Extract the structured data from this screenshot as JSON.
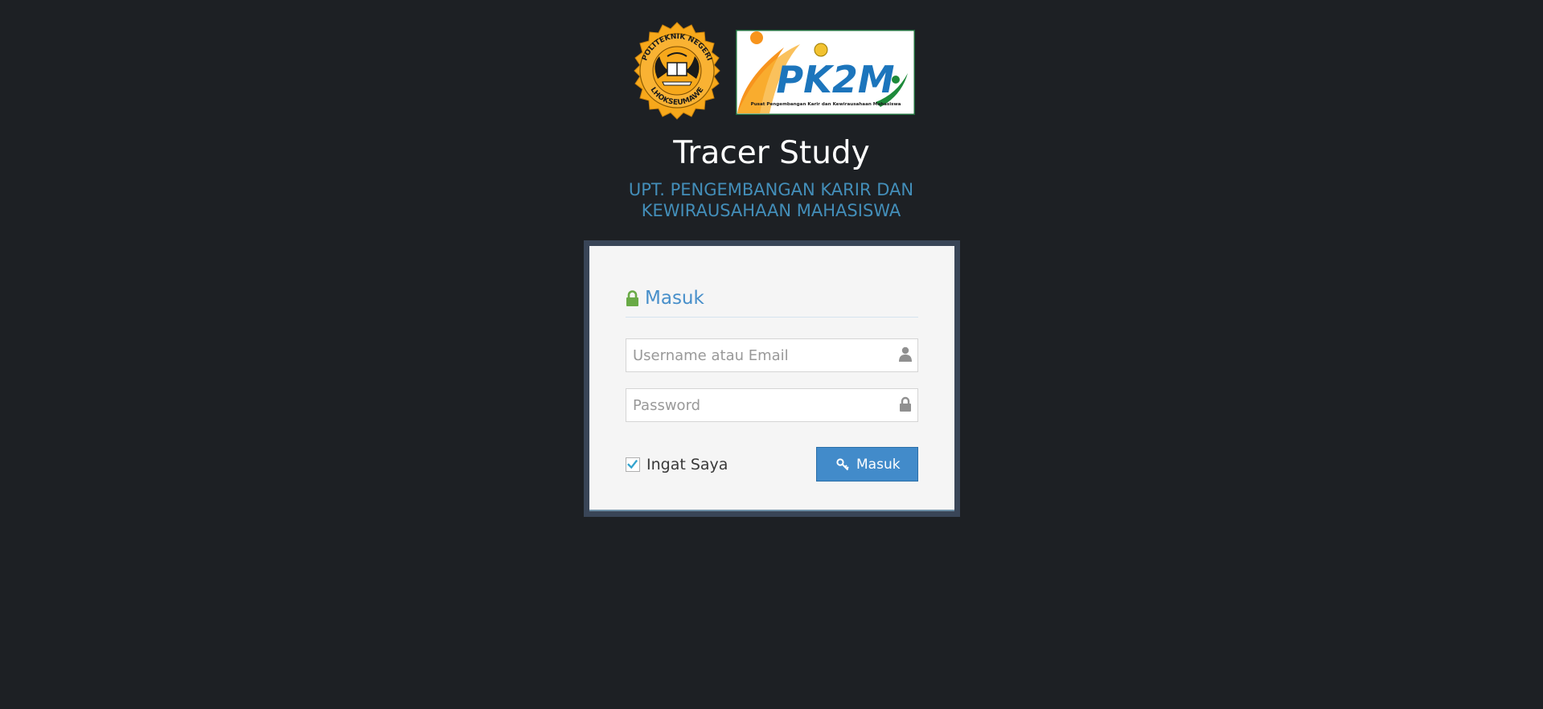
{
  "header": {
    "title": "Tracer Study",
    "subtitle": "UPT. PENGEMBANGAN KARIR DAN KEWIRAUSAHAAN MAHASISWA"
  },
  "logos": {
    "pnl": {
      "top_text": "POLITEKNIK NEGERI",
      "bottom_text": "LHOKSEUMAWE"
    },
    "pk2m": {
      "wordmark": "PK2M",
      "tagline": "Pusat Pengembangan Karir dan Kewirausahaan Mahasiswa"
    }
  },
  "login": {
    "heading": "Masuk",
    "username_placeholder": "Username atau Email",
    "password_placeholder": "Password",
    "remember_label": "Ingat Saya",
    "remember_checked": true,
    "submit_label": "Masuk"
  },
  "icons": {
    "heading": "lock-icon",
    "username": "user-icon",
    "password": "lock-icon",
    "submit": "key-icon",
    "remember": "check-icon"
  },
  "colors": {
    "background": "#1d2024",
    "title": "#ffffff",
    "subtitle": "#438eb9",
    "heading": "#478fca",
    "lock_green": "#69aa46",
    "button": "#428bca",
    "box_frame": "#394557"
  }
}
